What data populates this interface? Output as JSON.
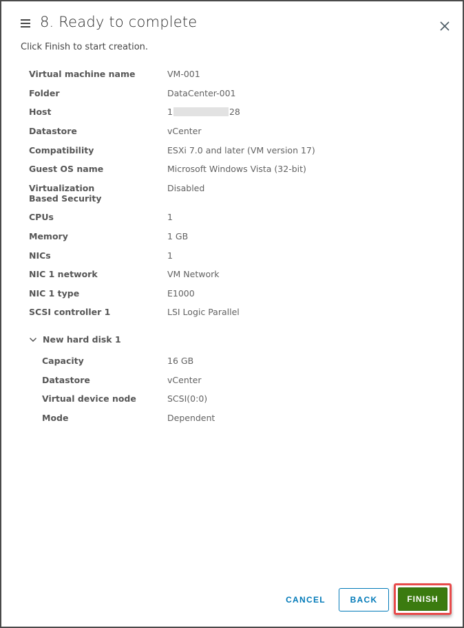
{
  "header": {
    "title": "8. Ready to complete",
    "subtitle": "Click Finish to start creation.",
    "menu_icon": "hamburger-icon",
    "close_icon": "close-icon"
  },
  "summary": [
    {
      "label": "Virtual machine name",
      "value": "VM-001"
    },
    {
      "label": "Folder",
      "value": "DataCenter-001"
    },
    {
      "label": "Host",
      "value_prefix": "1",
      "value_suffix": "28",
      "redacted": true
    },
    {
      "label": "Datastore",
      "value": "vCenter"
    },
    {
      "label": "Compatibility",
      "value": "ESXi 7.0 and later (VM version 17)"
    },
    {
      "label": "Guest OS name",
      "value": "Microsoft Windows Vista (32-bit)"
    },
    {
      "label": "Virtualization Based Security",
      "value": "Disabled"
    },
    {
      "label": "CPUs",
      "value": "1"
    },
    {
      "label": "Memory",
      "value": "1 GB"
    },
    {
      "label": "NICs",
      "value": "1"
    },
    {
      "label": "NIC 1 network",
      "value": "VM Network"
    },
    {
      "label": "NIC 1 type",
      "value": "E1000"
    },
    {
      "label": "SCSI controller 1",
      "value": "LSI Logic Parallel"
    }
  ],
  "disk_group": {
    "title": "New hard disk 1",
    "expanded": true,
    "items": [
      {
        "label": "Capacity",
        "value": "16 GB"
      },
      {
        "label": "Datastore",
        "value": "vCenter"
      },
      {
        "label": "Virtual device node",
        "value": "SCSI(0:0)"
      },
      {
        "label": "Mode",
        "value": "Dependent"
      }
    ]
  },
  "footer": {
    "cancel_label": "CANCEL",
    "back_label": "BACK",
    "finish_label": "FINISH"
  },
  "colors": {
    "primary": "#0079b8",
    "finish": "#3b7b10",
    "highlight": "#e84a4a"
  }
}
